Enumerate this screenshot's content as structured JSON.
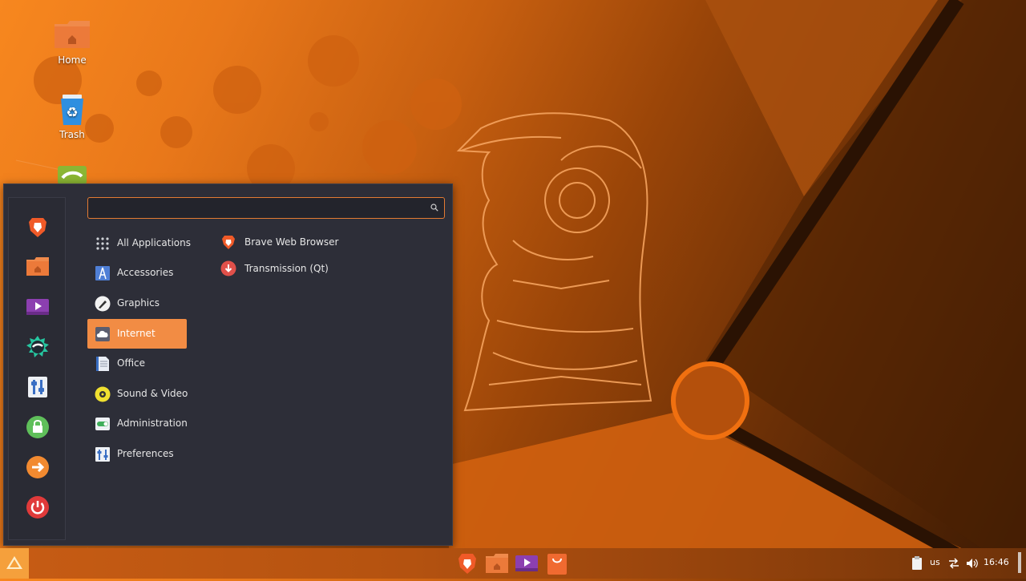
{
  "desktop": {
    "icons": [
      {
        "label": "Home",
        "icon": "home-folder-icon"
      },
      {
        "label": "Trash",
        "icon": "trash-icon"
      },
      {
        "label": "",
        "icon": "app-icon"
      }
    ]
  },
  "menu": {
    "search": {
      "value": "",
      "placeholder": "",
      "icon": "search-icon"
    },
    "favorites": [
      {
        "icon": "brave-browser-icon"
      },
      {
        "icon": "home-folder-icon"
      },
      {
        "icon": "media-player-icon"
      },
      {
        "icon": "bubble-app-icon"
      },
      {
        "icon": "settings-sliders-icon"
      },
      {
        "icon": "lock-screen-icon"
      },
      {
        "icon": "logout-icon"
      },
      {
        "icon": "power-icon"
      }
    ],
    "categories": [
      {
        "label": "All Applications",
        "icon": "grid-icon"
      },
      {
        "label": "Accessories",
        "icon": "accessories-icon"
      },
      {
        "label": "Graphics",
        "icon": "graphics-icon"
      },
      {
        "label": "Internet",
        "icon": "internet-icon",
        "selected": true
      },
      {
        "label": "Office",
        "icon": "office-icon"
      },
      {
        "label": "Sound & Video",
        "icon": "sound-video-icon"
      },
      {
        "label": "Administration",
        "icon": "administration-icon"
      },
      {
        "label": "Preferences",
        "icon": "preferences-icon"
      }
    ],
    "apps": [
      {
        "label": "Brave Web Browser",
        "icon": "brave-browser-icon"
      },
      {
        "label": "Transmission (Qt)",
        "icon": "transmission-icon"
      }
    ]
  },
  "panel": {
    "taskbar": [
      {
        "icon": "brave-browser-icon"
      },
      {
        "icon": "home-folder-icon"
      },
      {
        "icon": "media-player-icon"
      },
      {
        "icon": "software-store-icon"
      }
    ],
    "tray": {
      "keyboard_layout": "us",
      "clock": "16:46"
    }
  },
  "colors": {
    "accent": "#f28c44",
    "menu_bg": "#2d2e38",
    "panel_bg": "#b45210"
  }
}
